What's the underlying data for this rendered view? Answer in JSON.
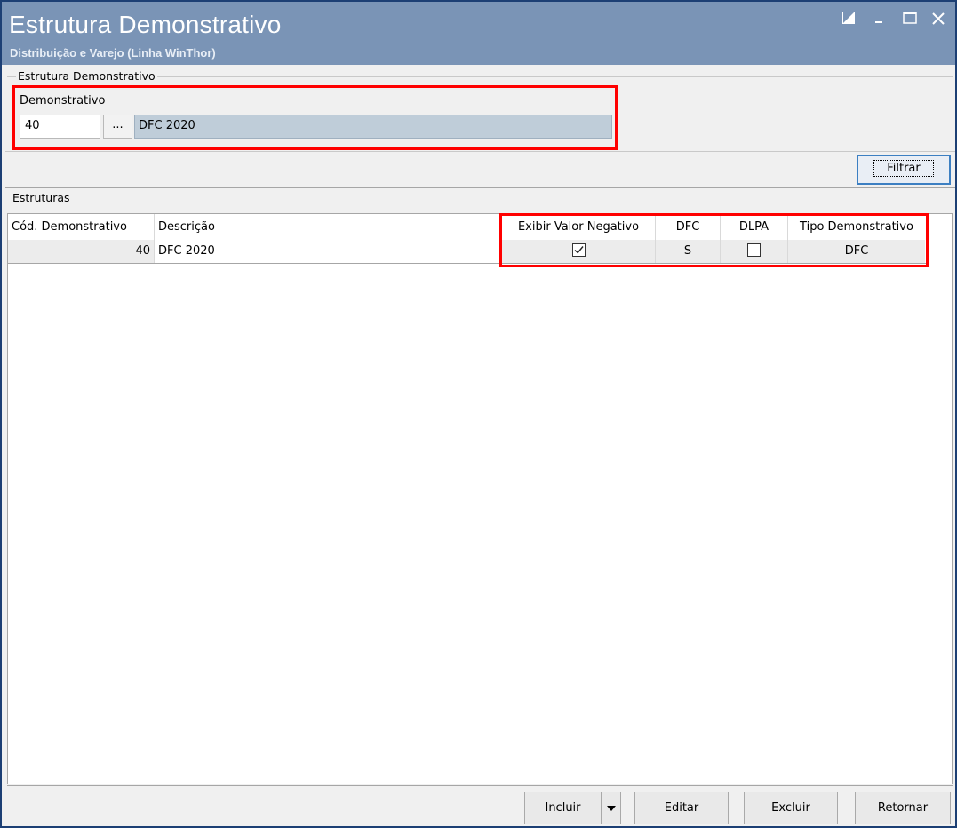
{
  "window": {
    "title": "Estrutura Demonstrativo",
    "subtitle": "Distribuição e Varejo (Linha WinThor)"
  },
  "filter_group": {
    "legend": "Estrutura Demonstrativo",
    "field_label": "Demonstrativo",
    "code_value": "40",
    "lookup_label": "...",
    "description_value": "DFC 2020",
    "filter_button_label": "Filtrar"
  },
  "grid": {
    "legend": "Estruturas",
    "columns": [
      "Cód. Demonstrativo",
      "Descrição",
      "Exibir Valor Negativo",
      "DFC",
      "DLPA",
      "Tipo Demonstrativo"
    ],
    "rows": [
      {
        "cod": "40",
        "descricao": "DFC 2020",
        "exibir_valor_negativo": true,
        "dfc": "S",
        "dlpa": false,
        "tipo": "DFC"
      }
    ]
  },
  "footer": {
    "incluir": "Incluir",
    "editar": "Editar",
    "excluir": "Excluir",
    "retornar": "Retornar"
  },
  "colors": {
    "titlebar": "#7a94b6",
    "highlight": "#ff0000",
    "description_field": "#bfcdd9"
  },
  "icons": {
    "restore": "restore-icon",
    "minimize": "minimize-icon",
    "maximize": "maximize-icon",
    "close": "close-icon",
    "dropdown": "dropdown-arrow-icon"
  }
}
